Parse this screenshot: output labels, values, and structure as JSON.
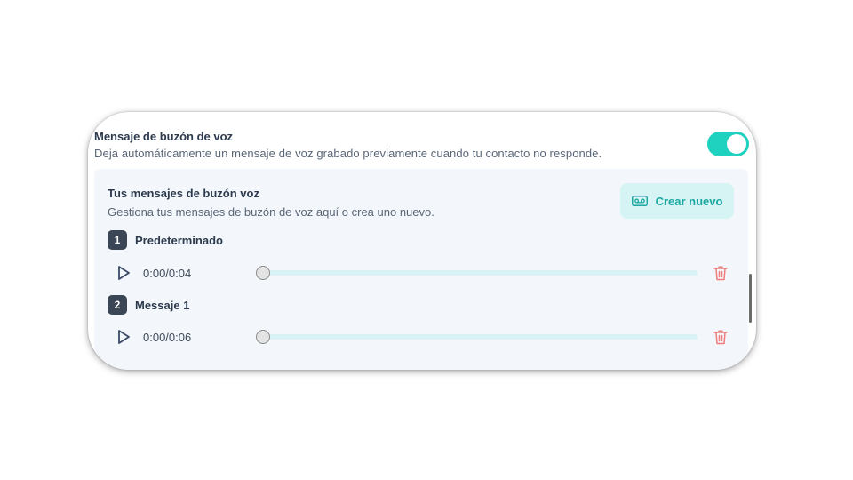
{
  "voicemail": {
    "title": "Mensaje de buzón de voz",
    "description": "Deja automáticamente un mensaje de voz grabado previamente cuando tu contacto no responde.",
    "enabled": true
  },
  "panel": {
    "title": "Tus mensajes de buzón voz",
    "description": "Gestiona tus mensajes de buzón de voz aquí o crea uno nuevo.",
    "create_button": {
      "label": "Crear nuevo",
      "icon": "voicemail-icon"
    }
  },
  "messages": [
    {
      "number": "1",
      "name": "Predeterminado",
      "time": "0:00/0:04",
      "progress": 0
    },
    {
      "number": "2",
      "name": "Messaje 1",
      "time": "0:00/0:06",
      "progress": 0
    }
  ],
  "icons": {
    "play": "play-icon",
    "delete": "trash-icon"
  },
  "colors": {
    "accent": "#1fd1bf",
    "accent_text": "#1aa7a1",
    "button_bg": "#d6f4f4",
    "delete": "#f07b7b",
    "badge": "#3a4556",
    "track": "#d9f2f5"
  }
}
